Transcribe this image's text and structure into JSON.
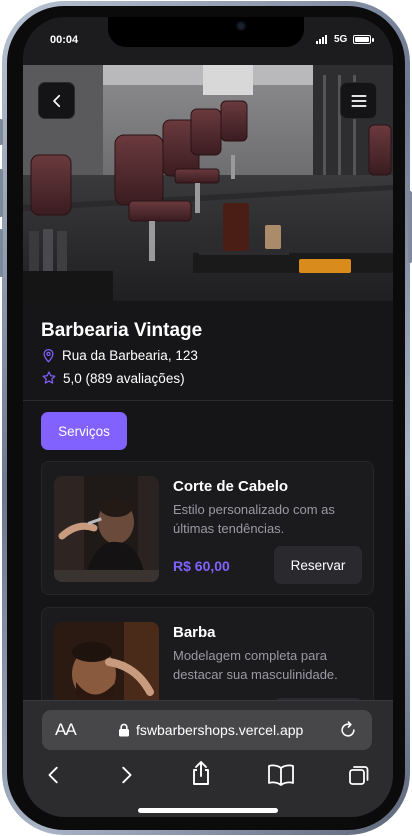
{
  "status_bar": {
    "time": "00:04",
    "network": "5G"
  },
  "shop": {
    "name": "Barbearia Vintage",
    "address": "Rua da Barbearia, 123",
    "rating": "5,0 (889 avaliações)"
  },
  "tabs": [
    {
      "label": "Serviços",
      "active": true
    }
  ],
  "services": [
    {
      "title": "Corte de Cabelo",
      "description": "Estilo personalizado com as últimas tendências.",
      "price": "R$ 60,00",
      "button": "Reservar"
    },
    {
      "title": "Barba",
      "description": "Modelagem completa para destacar sua masculinidade.",
      "price": "",
      "button": ""
    }
  ],
  "browser": {
    "text_size_label": "AA",
    "url": "fswbarbershops.vercel.app"
  },
  "colors": {
    "accent": "#8162ff",
    "background": "#151517",
    "card": "#1b1b1e"
  },
  "icons": [
    "back-icon",
    "menu-icon",
    "map-pin-icon",
    "star-icon",
    "lock-icon",
    "reload-icon",
    "chevron-left-icon",
    "chevron-right-icon",
    "share-icon",
    "bookmarks-icon",
    "tabs-icon"
  ]
}
